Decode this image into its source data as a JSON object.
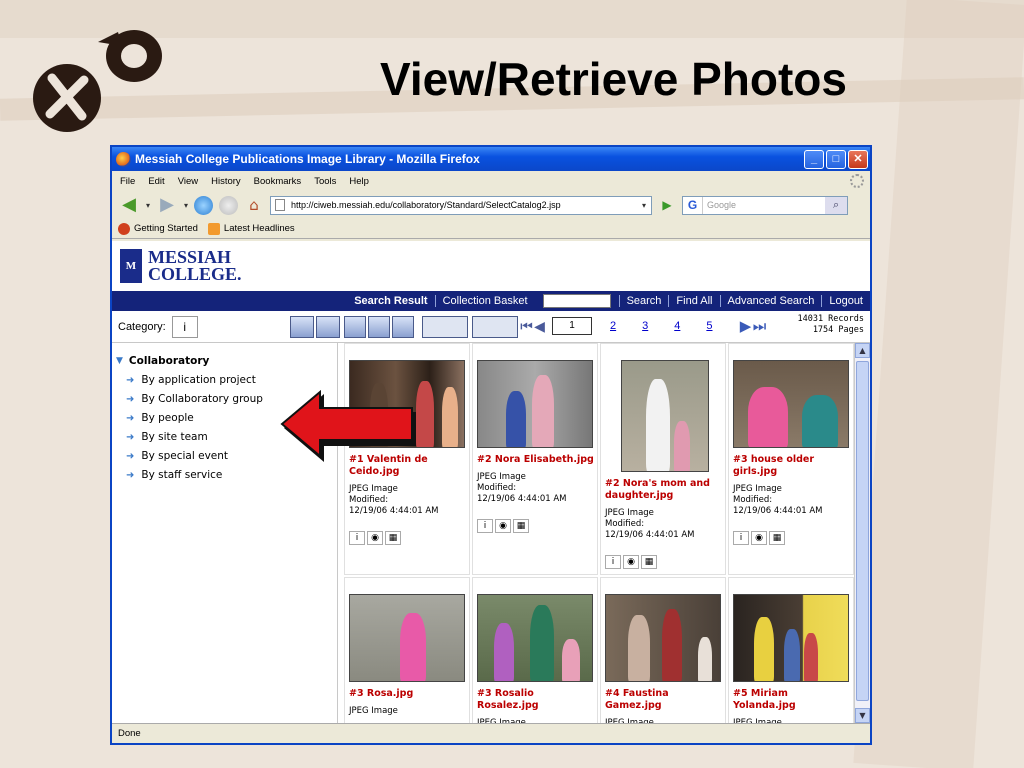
{
  "slide": {
    "title": "View/Retrieve Photos"
  },
  "browser": {
    "window_title": "Messiah College Publications Image Library - Mozilla Firefox",
    "title_buttons": {
      "minimize": "_",
      "maximize": "□",
      "close": "✕"
    },
    "menu": [
      "File",
      "Edit",
      "View",
      "History",
      "Bookmarks",
      "Tools",
      "Help"
    ],
    "url": "http://ciweb.messiah.edu/collaboratory/Standard/SelectCatalog2.jsp",
    "search_placeholder": "Google",
    "bookmarks": [
      "Getting Started",
      "Latest Headlines"
    ],
    "status": "Done"
  },
  "site": {
    "logo_line1": "MESSIAH",
    "logo_line2": "COLLEGE.",
    "nav": [
      "Search Result",
      "Collection Basket",
      "Search",
      "Find All",
      "Advanced Search",
      "Logout"
    ],
    "category_label": "Category:",
    "pager": {
      "current_page": "1",
      "pages": [
        "2",
        "3",
        "4",
        "5"
      ],
      "records": "14031 Records",
      "page_count": "1754 Pages"
    }
  },
  "tree": {
    "root": "Collaboratory",
    "items": [
      "By application project",
      "By Collaboratory group",
      "By people",
      "By site team",
      "By special event",
      "By staff service"
    ]
  },
  "photos": [
    {
      "caption": "#1 Valentin de Ceido.jpg",
      "type": "JPEG Image",
      "modified_label": "Modified:",
      "modified": "12/19/06 4:44:01 AM"
    },
    {
      "caption": "#2 Nora Elisabeth.jpg",
      "type": "JPEG Image",
      "modified_label": "Modified:",
      "modified": "12/19/06 4:44:01 AM"
    },
    {
      "caption": "#2 Nora's mom and daughter.jpg",
      "type": "JPEG Image",
      "modified_label": "Modified:",
      "modified": "12/19/06 4:44:01 AM"
    },
    {
      "caption": "#3 house older girls.jpg",
      "type": "JPEG Image",
      "modified_label": "Modified:",
      "modified": "12/19/06 4:44:01 AM"
    },
    {
      "caption": "#3 Rosa.jpg",
      "type": "JPEG Image"
    },
    {
      "caption": "#3 Rosalio Rosalez.jpg",
      "type": "JPEG Image"
    },
    {
      "caption": "#4 Faustina Gamez.jpg",
      "type": "JPEG Image"
    },
    {
      "caption": "#5 Miriam Yolanda.jpg",
      "type": "JPEG Image"
    }
  ],
  "colors": {
    "nav_bg": "#14237a",
    "caption": "#b00000",
    "arrow": "#e0141a"
  }
}
